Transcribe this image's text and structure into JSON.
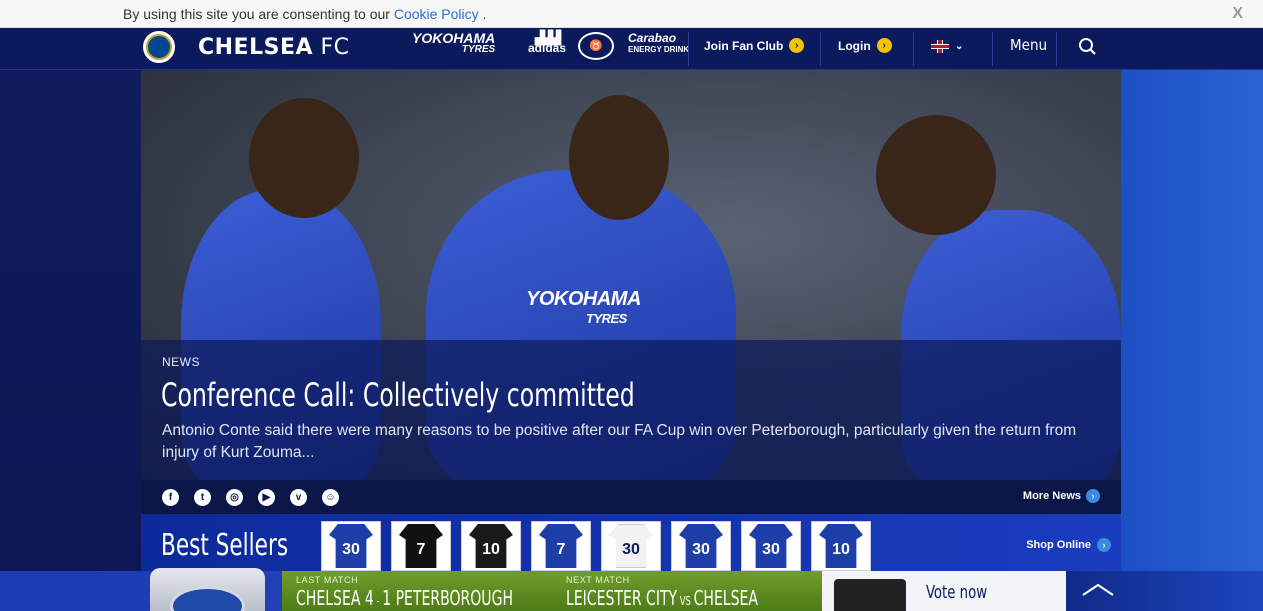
{
  "cookie": {
    "text": "By using this site you are consenting to our ",
    "link": "Cookie Policy",
    "suffix": " .",
    "close": "X"
  },
  "header": {
    "brand_main": "CHELSEA",
    "brand_fc": " FC",
    "sponsors": [
      {
        "name": "YOKOHAMA",
        "sub": "TYRES"
      },
      {
        "name": "adidas"
      },
      {
        "name": "Carabao",
        "sub": "ENERGY DRINK"
      }
    ],
    "join_label": "Join Fan Club",
    "login_label": "Login",
    "menu_label": "Menu"
  },
  "hero": {
    "category": "NEWS",
    "title": "Conference Call: Collectively committed",
    "description": "Antonio Conte said there were many reasons to be positive after our FA Cup win over Peterborough, particularly given the return from injury of Kurt Zouma...",
    "jersey_text": "YOKOHAMA",
    "jersey_sub": "TYRES"
  },
  "social": {
    "icons": [
      "facebook-icon",
      "twitter-icon",
      "instagram-icon",
      "youtube-icon",
      "vine-icon",
      "snapchat-icon"
    ],
    "more_news": "More News"
  },
  "best_sellers": {
    "title": "Best Sellers",
    "shirts": [
      {
        "number": "30",
        "color": "#1f3fa8"
      },
      {
        "number": "7",
        "color": "#111111"
      },
      {
        "number": "10",
        "color": "#1a1a1a"
      },
      {
        "number": "7",
        "color": "#1f3fa8"
      },
      {
        "number": "30",
        "color": "#f2f2f2"
      },
      {
        "number": "30",
        "color": "#1f3fa8"
      },
      {
        "number": "30",
        "color": "#1f3fa8"
      },
      {
        "number": "10",
        "color": "#1f3fa8"
      }
    ],
    "shop_online": "Shop Online"
  },
  "bottom": {
    "last_match_label": "LAST MATCH",
    "last_home": "CHELSEA 4",
    "last_dash": " - ",
    "last_away": "1 PETERBOROUGH",
    "next_match_label": "NEXT MATCH",
    "next_home": "LEICESTER CITY",
    "next_vs": " VS ",
    "next_away": "CHELSEA",
    "vote_label": "Vote now"
  }
}
